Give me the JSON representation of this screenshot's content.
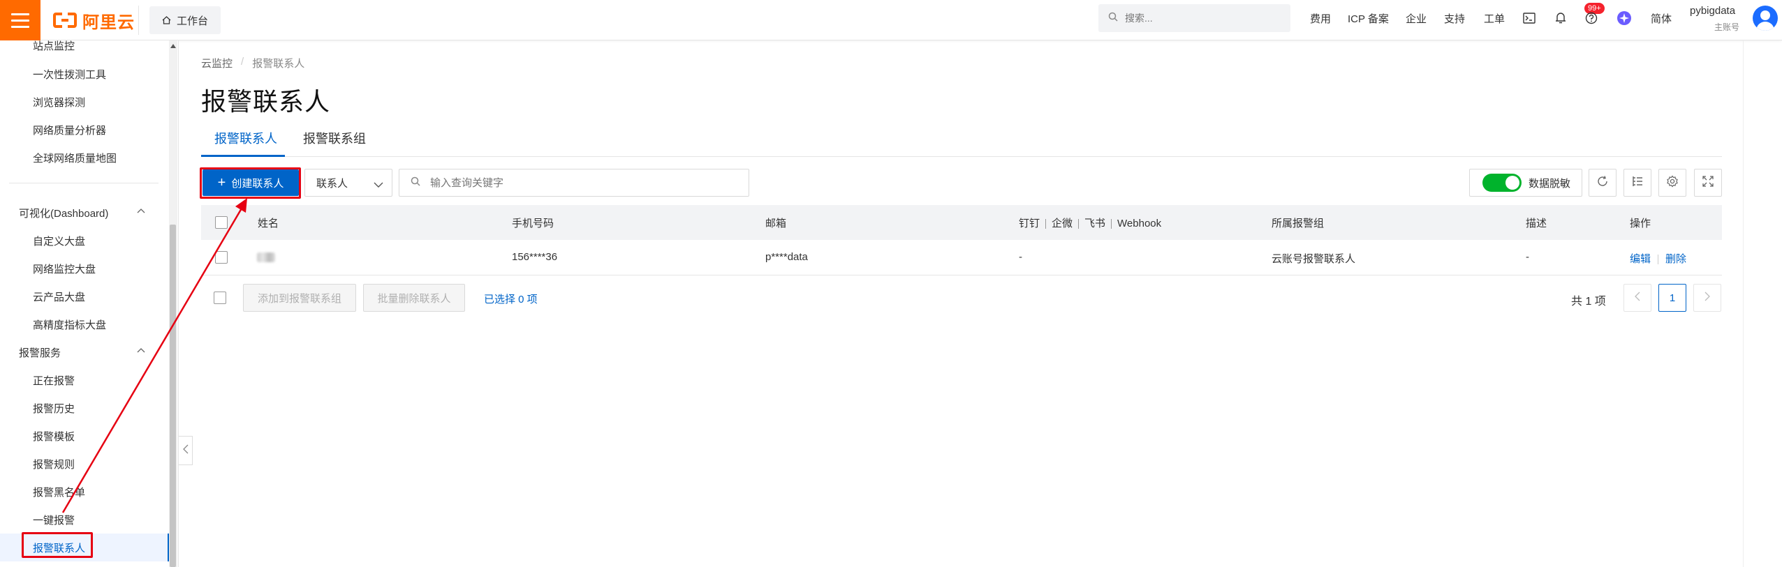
{
  "topbar": {
    "brand": "阿里云",
    "workbench": "工作台",
    "search_placeholder": "搜索...",
    "links": [
      "费用",
      "ICP 备案",
      "企业",
      "支持",
      "工单"
    ],
    "notification_badge": "99+",
    "language": "简体",
    "user_name": "pybigdata",
    "user_role": "主账号"
  },
  "sidebar": {
    "items_top": [
      "站点监控",
      "一次性拨测工具",
      "浏览器探测",
      "网络质量分析器",
      "全球网络质量地图"
    ],
    "group_dashboard": "可视化(Dashboard)",
    "items_dashboard": [
      "自定义大盘",
      "网络监控大盘",
      "云产品大盘",
      "高精度指标大盘"
    ],
    "group_alarm": "报警服务",
    "items_alarm": [
      "正在报警",
      "报警历史",
      "报警模板",
      "报警规则",
      "报警黑名单",
      "一键报警",
      "报警联系人"
    ]
  },
  "breadcrumb": [
    "云监控",
    "报警联系人"
  ],
  "page_title": "报警联系人",
  "tabs": [
    "报警联系人",
    "报警联系组"
  ],
  "toolbar": {
    "create_label": "创建联系人",
    "filter_selected": "联系人",
    "search_placeholder": "输入查询关键字",
    "toggle_label": "数据脱敏",
    "toggle_on": true
  },
  "table": {
    "headers": {
      "name": "姓名",
      "phone": "手机号码",
      "email": "邮箱",
      "channels": [
        "钉钉",
        "企微",
        "飞书",
        "Webhook"
      ],
      "group": "所属报警组",
      "desc": "描述",
      "ops": "操作"
    },
    "rows": [
      {
        "phone": "156****36",
        "email": "p****data",
        "channels": "-",
        "group": "云账号报警联系人",
        "desc": "-",
        "edit": "编辑",
        "delete": "删除"
      }
    ]
  },
  "footer": {
    "add_to_group": "添加到报警联系组",
    "batch_delete": "批量删除联系人",
    "selected": "已选择 0 项",
    "total": "共 1 项",
    "current_page": "1"
  },
  "colors": {
    "brand_orange": "#ff6a00",
    "primary_blue": "#0064c8",
    "annotation_red": "#e60012",
    "toggle_green": "#00b32c"
  }
}
